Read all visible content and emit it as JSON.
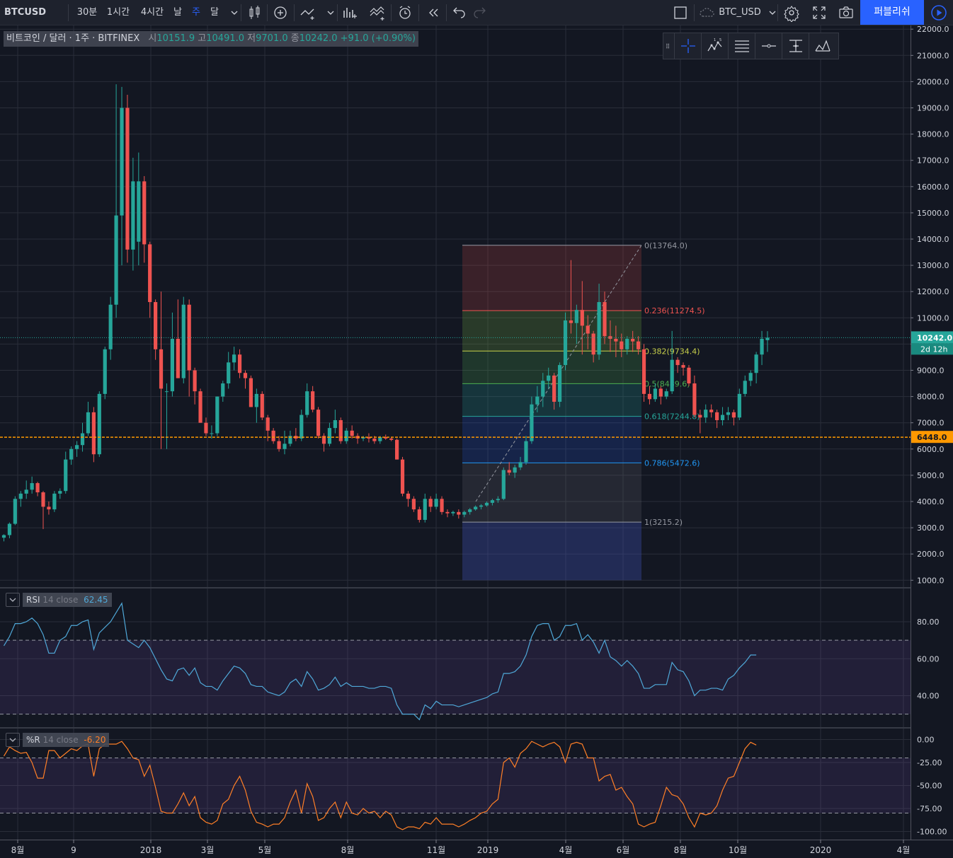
{
  "toolbar": {
    "symbol": "BTCUSD",
    "intervals": [
      "30분",
      "1시간",
      "4시간",
      "날",
      "주",
      "달"
    ],
    "active_interval": "주",
    "compare_symbol": "BTC_USD",
    "publish_label": "퍼블리쉬"
  },
  "legend": {
    "title": "비트코인 / 달러 · 1주 · BITFINEX",
    "open_label": "시",
    "open": "10151.9",
    "high_label": "고",
    "high": "10491.0",
    "low_label": "저",
    "low": "9701.0",
    "close_label": "종",
    "close": "10242.0",
    "change": "+91.0 (+0.90%)"
  },
  "colors": {
    "background": "#131722",
    "up": "#26a69a",
    "down": "#ef5350",
    "grid": "#2a2e39",
    "accent": "#2962ff",
    "price_line": "#26a69a",
    "alert_line": "#ff9800",
    "rsi": "#4fa8d8",
    "willr": "#ff7f27"
  },
  "price_scale": {
    "ticks": [
      "22000.0",
      "21000.0",
      "20000.0",
      "19000.0",
      "18000.0",
      "17000.0",
      "16000.0",
      "15000.0",
      "14000.0",
      "13000.0",
      "12000.0",
      "11000.0",
      "10000.0",
      "9000.0",
      "8000.0",
      "7000.0",
      "6000.0",
      "5000.0",
      "4000.0",
      "3000.0",
      "2000.0",
      "1000.0"
    ],
    "tick_values": [
      22000,
      21000,
      20000,
      19000,
      18000,
      17000,
      16000,
      15000,
      14000,
      13000,
      12000,
      11000,
      10000,
      9000,
      8000,
      7000,
      6000,
      5000,
      4000,
      3000,
      2000,
      1000
    ],
    "current_price": "10242.0",
    "current_price_value": 10242,
    "countdown": "2d 12h",
    "alert_price": "6448.0",
    "alert_price_value": 6448
  },
  "time_axis": {
    "labels": [
      "8월",
      "9",
      "2018",
      "3월",
      "5월",
      "8월",
      "11월",
      "2019",
      "4월",
      "6월",
      "8월",
      "10월",
      "2020",
      "4월"
    ]
  },
  "fibonacci": {
    "levels": [
      {
        "ratio": 0,
        "label": "0(13764.0)",
        "price": 13764.0,
        "color": "#9598a1",
        "fill": "rgba(239,83,80,0.18)"
      },
      {
        "ratio": 0.236,
        "label": "0.236(11274.5)",
        "price": 11274.5,
        "color": "#ef5350",
        "fill": "rgba(129,199,72,0.20)"
      },
      {
        "ratio": 0.382,
        "label": "0.382(9734.4)",
        "price": 9734.4,
        "color": "#c8d04b",
        "fill": "rgba(76,175,80,0.22)"
      },
      {
        "ratio": 0.5,
        "label": "0.5(8489.6)",
        "price": 8489.6,
        "color": "#4caf50",
        "fill": "rgba(38,166,154,0.22)"
      },
      {
        "ratio": 0.618,
        "label": "0.618(7244.8)",
        "price": 7244.8,
        "color": "#26a69a",
        "fill": "rgba(41,98,255,0.18)"
      },
      {
        "ratio": 0.786,
        "label": "0.786(5472.6)",
        "price": 5472.6,
        "color": "#2196f3",
        "fill": "rgba(120,123,134,0.18)"
      },
      {
        "ratio": 1,
        "label": "1(3215.2)",
        "price": 3215.2,
        "color": "#9598a1",
        "fill": "rgba(63,81,181,0.35)"
      }
    ],
    "extension_price": 1000
  },
  "rsi": {
    "name": "RSI",
    "params": "14 close",
    "value": "62.45",
    "ticks": [
      "80.00",
      "60.00",
      "40.00"
    ],
    "tick_values": [
      80,
      60,
      40
    ],
    "band": [
      30,
      70
    ]
  },
  "willr": {
    "name": "%R",
    "params": "14 close",
    "value": "-6.20",
    "ticks": [
      "0.00",
      "-25.00",
      "-50.00",
      "-75.00",
      "-100.00"
    ],
    "tick_values": [
      0,
      -25,
      -50,
      -75,
      -100
    ],
    "band": [
      -80,
      -20
    ]
  },
  "chart_data": {
    "type": "candlestick",
    "interval": "1W",
    "candles": [
      [
        2620,
        2750,
        2480,
        2720
      ],
      [
        2720,
        3200,
        2600,
        3150
      ],
      [
        3150,
        4200,
        3100,
        4100
      ],
      [
        4100,
        4400,
        3800,
        4300
      ],
      [
        4300,
        4800,
        4100,
        4450
      ],
      [
        4450,
        4950,
        4300,
        4700
      ],
      [
        4700,
        4750,
        4200,
        4350
      ],
      [
        4350,
        4400,
        2950,
        3800
      ],
      [
        3800,
        4000,
        3500,
        3700
      ],
      [
        3700,
        4400,
        3600,
        4300
      ],
      [
        4300,
        4500,
        4100,
        4400
      ],
      [
        4400,
        5900,
        4300,
        5600
      ],
      [
        5600,
        6100,
        5400,
        6000
      ],
      [
        6000,
        6300,
        5700,
        6150
      ],
      [
        6150,
        7000,
        5900,
        6600
      ],
      [
        6600,
        7800,
        6500,
        7400
      ],
      [
        7400,
        7600,
        5500,
        5800
      ],
      [
        5800,
        8200,
        5700,
        8100
      ],
      [
        8100,
        9900,
        7900,
        9800
      ],
      [
        9800,
        11800,
        9400,
        11500
      ],
      [
        11500,
        19900,
        11000,
        14900
      ],
      [
        14900,
        19800,
        13000,
        19000
      ],
      [
        19000,
        19500,
        13100,
        13600
      ],
      [
        13600,
        17100,
        12800,
        16200
      ],
      [
        13900,
        17300,
        13000,
        16200
      ],
      [
        16200,
        16400,
        13100,
        13800
      ],
      [
        13800,
        13900,
        11000,
        11600
      ],
      [
        11600,
        11700,
        9400,
        9800
      ],
      [
        9800,
        12000,
        6000,
        8300
      ],
      [
        8200,
        8500,
        6000,
        8200
      ],
      [
        8200,
        11200,
        8000,
        10200
      ],
      [
        10200,
        11700,
        8700,
        8700
      ],
      [
        8700,
        11800,
        8500,
        11500
      ],
      [
        11500,
        11700,
        8000,
        9000
      ],
      [
        9000,
        9100,
        7700,
        8200
      ],
      [
        8200,
        8300,
        7000,
        7000
      ],
      [
        7000,
        7200,
        6500,
        6600
      ],
      [
        6600,
        6900,
        6400,
        6600
      ],
      [
        6600,
        8000,
        6500,
        8000
      ],
      [
        8000,
        8600,
        7800,
        8500
      ],
      [
        8500,
        9700,
        8300,
        9300
      ],
      [
        9300,
        9900,
        9000,
        9600
      ],
      [
        9600,
        9800,
        8700,
        8900
      ],
      [
        8900,
        9000,
        8300,
        8700
      ],
      [
        8700,
        8800,
        7600,
        7600
      ],
      [
        7600,
        8300,
        7000,
        8100
      ],
      [
        8100,
        8200,
        7100,
        7200
      ],
      [
        7200,
        7300,
        6300,
        6700
      ],
      [
        6700,
        6800,
        6200,
        6300
      ],
      [
        6300,
        6500,
        5900,
        6000
      ],
      [
        6000,
        6700,
        5800,
        6200
      ],
      [
        6200,
        6700,
        6100,
        6500
      ],
      [
        6500,
        6800,
        6300,
        6400
      ],
      [
        6400,
        7500,
        6300,
        7300
      ],
      [
        7300,
        8500,
        7200,
        8200
      ],
      [
        8200,
        8400,
        7400,
        7500
      ],
      [
        7500,
        7600,
        6400,
        6500
      ],
      [
        6500,
        6600,
        5900,
        6200
      ],
      [
        6200,
        7000,
        6100,
        6800
      ],
      [
        6800,
        7500,
        6600,
        7100
      ],
      [
        7100,
        7200,
        6200,
        6300
      ],
      [
        6300,
        6800,
        6200,
        6700
      ],
      [
        6700,
        6900,
        6400,
        6500
      ],
      [
        6500,
        6600,
        6200,
        6400
      ],
      [
        6400,
        6500,
        6300,
        6450
      ],
      [
        6450,
        6600,
        6250,
        6400
      ],
      [
        6400,
        6500,
        6200,
        6300
      ],
      [
        6300,
        6500,
        6200,
        6450
      ],
      [
        6450,
        6550,
        6350,
        6400
      ],
      [
        6400,
        6450,
        6300,
        6350
      ],
      [
        6350,
        6400,
        5600,
        5600
      ],
      [
        5600,
        5700,
        4200,
        4300
      ],
      [
        4300,
        4400,
        3800,
        4100
      ],
      [
        4100,
        4200,
        3600,
        3700
      ],
      [
        3700,
        3800,
        3200,
        3300
      ],
      [
        3300,
        4300,
        3200,
        4100
      ],
      [
        4100,
        4200,
        3600,
        3800
      ],
      [
        3800,
        4300,
        3700,
        4100
      ],
      [
        4100,
        4200,
        3500,
        3600
      ],
      [
        3600,
        3700,
        3400,
        3550
      ],
      [
        3550,
        3650,
        3450,
        3600
      ],
      [
        3600,
        3700,
        3350,
        3500
      ],
      [
        3500,
        3650,
        3400,
        3600
      ],
      [
        3600,
        3750,
        3500,
        3700
      ],
      [
        3700,
        3850,
        3650,
        3800
      ],
      [
        3800,
        3900,
        3700,
        3850
      ],
      [
        3850,
        4000,
        3800,
        3950
      ],
      [
        3950,
        4100,
        3850,
        4050
      ],
      [
        4050,
        4200,
        3950,
        4100
      ],
      [
        4100,
        5300,
        4050,
        5200
      ],
      [
        5200,
        5500,
        5000,
        5100
      ],
      [
        5100,
        5400,
        4900,
        5300
      ],
      [
        5300,
        5700,
        5200,
        5500
      ],
      [
        5500,
        6500,
        5400,
        6300
      ],
      [
        6300,
        8000,
        6200,
        7700
      ],
      [
        7700,
        8400,
        7400,
        8000
      ],
      [
        8000,
        8900,
        7600,
        8600
      ],
      [
        8600,
        9100,
        8300,
        8800
      ],
      [
        8800,
        8900,
        7500,
        7800
      ],
      [
        7800,
        9300,
        7600,
        9200
      ],
      [
        9200,
        11200,
        9000,
        10900
      ],
      [
        10900,
        13200,
        10400,
        10800
      ],
      [
        10800,
        11500,
        10000,
        11300
      ],
      [
        11300,
        12400,
        9600,
        10700
      ],
      [
        10700,
        11100,
        9800,
        10400
      ],
      [
        10400,
        10500,
        9300,
        9600
      ],
      [
        9600,
        12300,
        9400,
        11600
      ],
      [
        11600,
        12000,
        10000,
        10300
      ],
      [
        10300,
        10900,
        9700,
        10200
      ],
      [
        10200,
        10700,
        9500,
        10100
      ],
      [
        10100,
        10400,
        9500,
        9800
      ],
      [
        9800,
        10300,
        9600,
        10200
      ],
      [
        10200,
        10500,
        9700,
        10100
      ],
      [
        10100,
        10300,
        9600,
        9800
      ],
      [
        9800,
        10000,
        7800,
        8100
      ],
      [
        8100,
        8400,
        7700,
        7900
      ],
      [
        7900,
        8500,
        7800,
        8300
      ],
      [
        8300,
        8400,
        7700,
        8000
      ],
      [
        8000,
        8300,
        7900,
        8200
      ],
      [
        8200,
        10500,
        8100,
        9400
      ],
      [
        9400,
        9500,
        8900,
        9200
      ],
      [
        9200,
        9300,
        8800,
        9100
      ],
      [
        9100,
        9200,
        8400,
        8500
      ],
      [
        8500,
        8800,
        7200,
        7300
      ],
      [
        7300,
        7500,
        6600,
        7200
      ],
      [
        7200,
        7700,
        7000,
        7500
      ],
      [
        7500,
        7700,
        7200,
        7400
      ],
      [
        7400,
        7500,
        6800,
        7100
      ],
      [
        7100,
        7600,
        6900,
        7300
      ],
      [
        7300,
        7600,
        7100,
        7400
      ],
      [
        7400,
        7500,
        6900,
        7200
      ],
      [
        7200,
        8300,
        7100,
        8100
      ],
      [
        8100,
        8800,
        8000,
        8600
      ],
      [
        8600,
        9000,
        8400,
        8900
      ],
      [
        8900,
        9700,
        8500,
        9600
      ],
      [
        9600,
        10500,
        9200,
        10200
      ],
      [
        10150,
        10491,
        9701,
        10242
      ]
    ],
    "rsi_values": [
      67,
      72,
      79,
      79,
      80,
      82,
      79,
      73,
      63,
      63,
      70,
      72,
      78,
      78,
      80,
      81,
      65,
      74,
      77,
      80,
      85,
      90,
      70,
      68,
      66,
      70,
      66,
      60,
      54,
      49,
      48,
      54,
      55,
      51,
      55,
      47,
      45,
      45,
      43,
      48,
      52,
      56,
      55,
      52,
      46,
      45,
      45,
      42,
      41,
      40,
      42,
      47,
      49,
      45,
      53,
      49,
      43,
      44,
      46,
      50,
      45,
      47,
      45,
      45,
      45,
      44,
      44,
      45,
      45,
      44,
      35,
      30,
      30,
      30,
      27,
      35,
      33,
      37,
      35,
      35,
      35,
      34,
      35,
      36,
      37,
      38,
      39,
      41,
      42,
      52,
      52,
      53,
      56,
      62,
      72,
      78,
      79,
      79,
      70,
      72,
      78,
      78,
      79,
      70,
      73,
      69,
      63,
      70,
      61,
      59,
      56,
      59,
      56,
      52,
      44,
      44,
      46,
      46,
      46,
      58,
      54,
      53,
      48,
      40,
      43,
      43,
      44,
      44,
      43,
      49,
      51,
      55,
      58,
      62,
      62
    ],
    "willr_values": [
      -18,
      -8,
      -12,
      -15,
      -14,
      -25,
      -42,
      -42,
      -12,
      -12,
      -20,
      -15,
      -10,
      -12,
      -7,
      -5,
      -40,
      -10,
      -5,
      -5,
      -5,
      -2,
      -10,
      -20,
      -22,
      -40,
      -28,
      -52,
      -78,
      -80,
      -80,
      -70,
      -58,
      -72,
      -62,
      -85,
      -90,
      -92,
      -88,
      -70,
      -65,
      -50,
      -40,
      -55,
      -78,
      -90,
      -92,
      -95,
      -92,
      -92,
      -85,
      -68,
      -55,
      -80,
      -48,
      -62,
      -88,
      -85,
      -75,
      -68,
      -85,
      -68,
      -80,
      -82,
      -75,
      -80,
      -78,
      -85,
      -78,
      -82,
      -95,
      -98,
      -95,
      -95,
      -97,
      -90,
      -92,
      -85,
      -92,
      -92,
      -92,
      -95,
      -92,
      -88,
      -85,
      -80,
      -78,
      -70,
      -65,
      -25,
      -20,
      -30,
      -15,
      -10,
      -2,
      -5,
      -8,
      -5,
      -3,
      -8,
      -25,
      -5,
      -3,
      -5,
      -20,
      -20,
      -45,
      -40,
      -38,
      -55,
      -52,
      -62,
      -70,
      -92,
      -95,
      -92,
      -90,
      -72,
      -52,
      -60,
      -62,
      -70,
      -85,
      -95,
      -80,
      -82,
      -80,
      -72,
      -55,
      -42,
      -40,
      -25,
      -10,
      -3,
      -6
    ]
  }
}
